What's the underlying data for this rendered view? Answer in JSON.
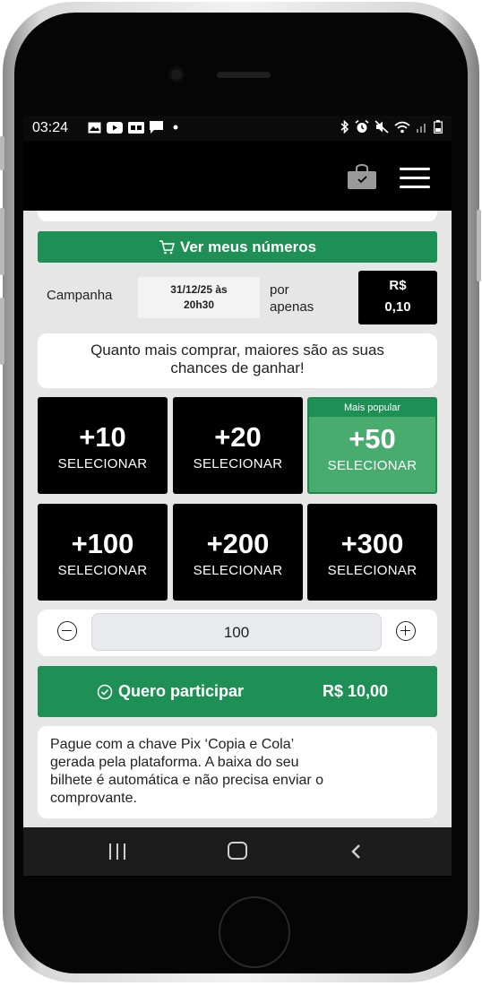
{
  "status_bar": {
    "time": "03:24",
    "left_icons": [
      "image-icon",
      "youtube-icon",
      "caption-icon",
      "chat-icon",
      "dot-icon"
    ],
    "right_icons": [
      "bluetooth-icon",
      "alarm-icon",
      "mute-icon",
      "wifi-icon",
      "signal-icon",
      "battery-icon"
    ]
  },
  "header": {
    "icons": [
      "shopping-bag-icon",
      "hamburger-menu-icon"
    ]
  },
  "main": {
    "ver_numeros_label": "Ver meus números",
    "campaign": {
      "label": "Campanha",
      "date_line1": "31/12/25 às",
      "date_line2": "20h30",
      "por_line1": "por",
      "por_line2": "apenas",
      "price_currency": "R$",
      "price_value": "0,10"
    },
    "info_text_line1": "Quanto mais comprar, maiores são as suas",
    "info_text_line2": "chances de ganhar!",
    "options": [
      {
        "amount": "+10",
        "action": "SELECIONAR"
      },
      {
        "amount": "+20",
        "action": "SELECIONAR"
      },
      {
        "amount": "+50",
        "action": "SELECIONAR",
        "badge": "Mais popular"
      },
      {
        "amount": "+100",
        "action": "SELECIONAR"
      },
      {
        "amount": "+200",
        "action": "SELECIONAR"
      },
      {
        "amount": "+300",
        "action": "SELECIONAR"
      }
    ],
    "quantity": "100",
    "participate": {
      "label": "Quero participar",
      "total": "R$ 10,00"
    },
    "pix_info_lines": [
      "Pague com a chave Pix ‘Copia e Cola’",
      "gerada pela plataforma. A baixa do seu",
      "bilhete é automática e não precisa enviar o",
      "comprovante."
    ]
  },
  "nav_bar": {
    "icons": [
      "recent-apps-icon",
      "home-icon",
      "back-icon"
    ]
  },
  "colors": {
    "primary_green": "#1f9055",
    "popular_green": "#47ac6e",
    "black": "#000000",
    "background": "#e6e6e6"
  }
}
